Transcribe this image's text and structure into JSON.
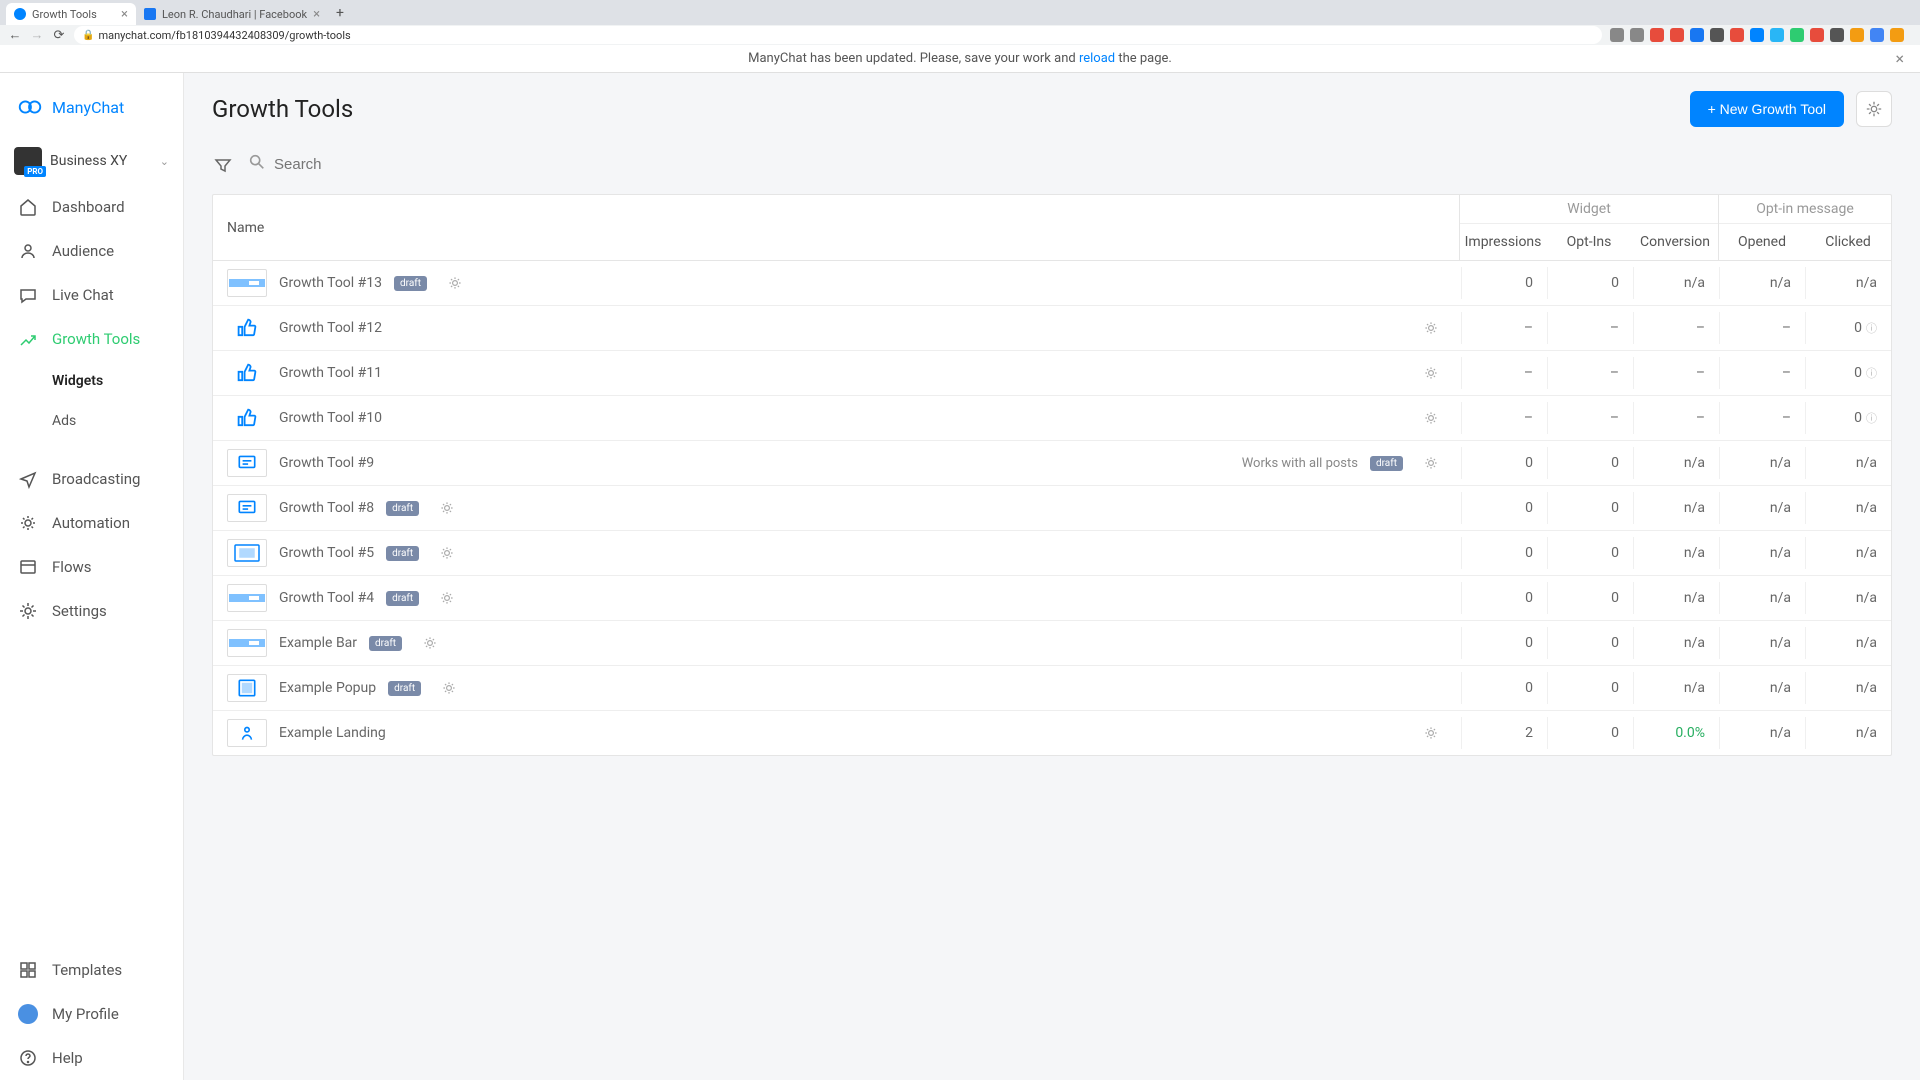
{
  "browser": {
    "tabs": [
      {
        "title": "Growth Tools",
        "active": true,
        "icon": "manychat"
      },
      {
        "title": "Leon R. Chaudhari | Facebook",
        "active": false,
        "icon": "facebook"
      }
    ],
    "url": "manychat.com/fb181039443240830​9/growth-tools",
    "ext_colors": [
      "#888",
      "#888",
      "#e74c3c",
      "#e74c3c",
      "#1877f2",
      "#555",
      "#e74c3c",
      "#0084ff",
      "#29b6f6",
      "#2ecc71",
      "#e74c3c",
      "#555",
      "#f39c12",
      "#4285f4",
      "#f39c12"
    ]
  },
  "banner": {
    "text_before": "ManyChat has been updated. Please, save your work and ",
    "link": "reload",
    "text_after": " the page."
  },
  "sidebar": {
    "brand": "ManyChat",
    "business": {
      "name": "Business XY",
      "badge": "PRO"
    },
    "items": {
      "dashboard": "Dashboard",
      "audience": "Audience",
      "livechat": "Live Chat",
      "growth": "Growth Tools",
      "widgets": "Widgets",
      "ads": "Ads",
      "broadcasting": "Broadcasting",
      "automation": "Automation",
      "flows": "Flows",
      "settings": "Settings",
      "templates": "Templates",
      "profile": "My Profile",
      "help": "Help"
    }
  },
  "page": {
    "title": "Growth Tools",
    "new_btn": "+ New Growth Tool",
    "search_placeholder": "Search"
  },
  "table": {
    "headers": {
      "name": "Name",
      "widget": "Widget",
      "optin": "Opt-in message",
      "impressions": "Impressions",
      "optins": "Opt-Ins",
      "conversion": "Conversion",
      "opened": "Opened",
      "clicked": "Clicked"
    },
    "rows": [
      {
        "name": "Growth Tool #13",
        "thumb": "bar",
        "draft": true,
        "imp": "0",
        "opt": "0",
        "conv": "n/a",
        "opened": "n/a",
        "clicked": "n/a",
        "annot": "",
        "q": false
      },
      {
        "name": "Growth Tool #12",
        "thumb": "thumbs",
        "draft": false,
        "imp": "–",
        "opt": "–",
        "conv": "–",
        "opened": "–",
        "clicked": "0",
        "annot": "",
        "q": true
      },
      {
        "name": "Growth Tool #11",
        "thumb": "thumbs",
        "draft": false,
        "imp": "–",
        "opt": "–",
        "conv": "–",
        "opened": "–",
        "clicked": "0",
        "annot": "",
        "q": true
      },
      {
        "name": "Growth Tool #10",
        "thumb": "thumbs",
        "draft": false,
        "imp": "–",
        "opt": "–",
        "conv": "–",
        "opened": "–",
        "clicked": "0",
        "annot": "",
        "q": true
      },
      {
        "name": "Growth Tool #9",
        "thumb": "comment",
        "draft": true,
        "imp": "0",
        "opt": "0",
        "conv": "n/a",
        "opened": "n/a",
        "clicked": "n/a",
        "annot": "Works with all posts",
        "q": false
      },
      {
        "name": "Growth Tool #8",
        "thumb": "comment",
        "draft": true,
        "imp": "0",
        "opt": "0",
        "conv": "n/a",
        "opened": "n/a",
        "clicked": "n/a",
        "annot": "",
        "q": false
      },
      {
        "name": "Growth Tool #5",
        "thumb": "modal",
        "draft": true,
        "imp": "0",
        "opt": "0",
        "conv": "n/a",
        "opened": "n/a",
        "clicked": "n/a",
        "annot": "",
        "q": false
      },
      {
        "name": "Growth Tool #4",
        "thumb": "bar",
        "draft": true,
        "imp": "0",
        "opt": "0",
        "conv": "n/a",
        "opened": "n/a",
        "clicked": "n/a",
        "annot": "",
        "q": false
      },
      {
        "name": "Example Bar",
        "thumb": "bar",
        "draft": true,
        "imp": "0",
        "opt": "0",
        "conv": "n/a",
        "opened": "n/a",
        "clicked": "n/a",
        "annot": "",
        "q": false
      },
      {
        "name": "Example Popup",
        "thumb": "popup",
        "draft": true,
        "imp": "0",
        "opt": "0",
        "conv": "n/a",
        "opened": "n/a",
        "clicked": "n/a",
        "annot": "",
        "q": false
      },
      {
        "name": "Example Landing",
        "thumb": "landing",
        "draft": false,
        "imp": "2",
        "opt": "0",
        "conv": "0.0%",
        "opened": "n/a",
        "clicked": "n/a",
        "annot": "",
        "q": false,
        "conv_green": true
      }
    ],
    "draft_label": "draft"
  }
}
